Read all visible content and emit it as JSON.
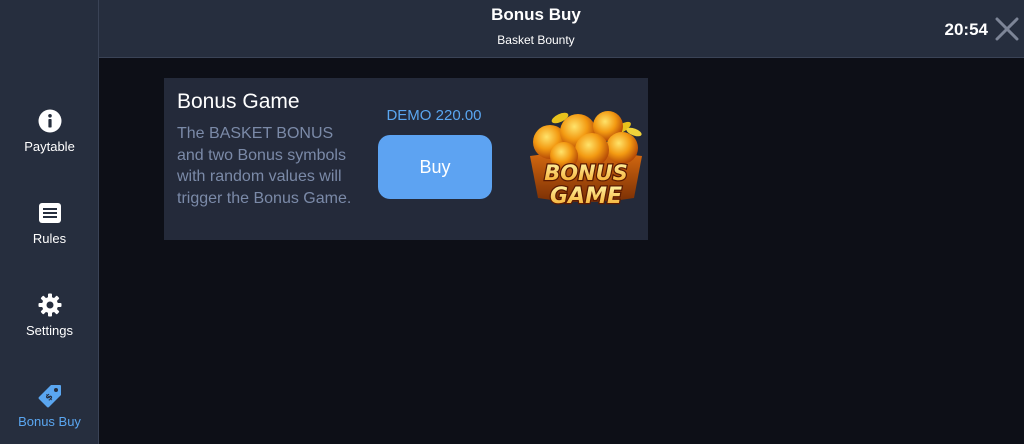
{
  "header": {
    "title": "Bonus Buy",
    "subtitle": "Basket Bounty",
    "time": "20:54"
  },
  "sidebar": {
    "items": [
      {
        "label": "Paytable",
        "icon": "info-icon",
        "active": false
      },
      {
        "label": "Rules",
        "icon": "list-icon",
        "active": false
      },
      {
        "label": "Settings",
        "icon": "gear-icon",
        "active": false
      },
      {
        "label": "Bonus Buy",
        "icon": "price-tag-icon",
        "active": true
      }
    ]
  },
  "bonus_card": {
    "title": "Bonus Game",
    "description": "The BASKET BONUS and two Bonus symbols with random values will trigger the Bonus Game.",
    "price": "DEMO 220.00",
    "buy_label": "Buy",
    "art_text_line1": "BONUS",
    "art_text_line2": "GAME"
  },
  "colors": {
    "accent": "#5aa6f0",
    "panel": "#262e3e",
    "background": "#0d0f17",
    "card": "#242a3a",
    "muted_text": "#7b8aa8"
  }
}
